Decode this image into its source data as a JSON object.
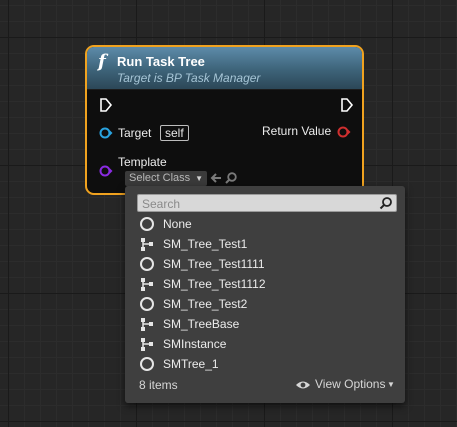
{
  "node": {
    "title": "Run Task Tree",
    "subtitle": "Target is BP Task Manager",
    "func_icon": "f",
    "pins": {
      "target_label": "Target",
      "self_badge": "self",
      "return_label": "Return Value",
      "template_label": "Template",
      "select_class": "Select Class"
    }
  },
  "dropdown": {
    "search_placeholder": "Search",
    "items": [
      {
        "label": "None",
        "icon": "circle-icon"
      },
      {
        "label": "SM_Tree_Test1",
        "icon": "tree-icon"
      },
      {
        "label": "SM_Tree_Test1111",
        "icon": "circle-icon"
      },
      {
        "label": "SM_Tree_Test1112",
        "icon": "tree-icon"
      },
      {
        "label": "SM_Tree_Test2",
        "icon": "circle-icon"
      },
      {
        "label": "SM_TreeBase",
        "icon": "tree-icon"
      },
      {
        "label": "SMInstance",
        "icon": "tree-icon"
      },
      {
        "label": "SMTree_1",
        "icon": "circle-icon"
      }
    ],
    "count_label": "8 items",
    "view_options_label": "View Options"
  },
  "colors": {
    "node_border": "#f0a21f",
    "target_pin": "#29a3e0",
    "return_pin": "#d02f2f",
    "template_pin": "#8a2be2"
  }
}
